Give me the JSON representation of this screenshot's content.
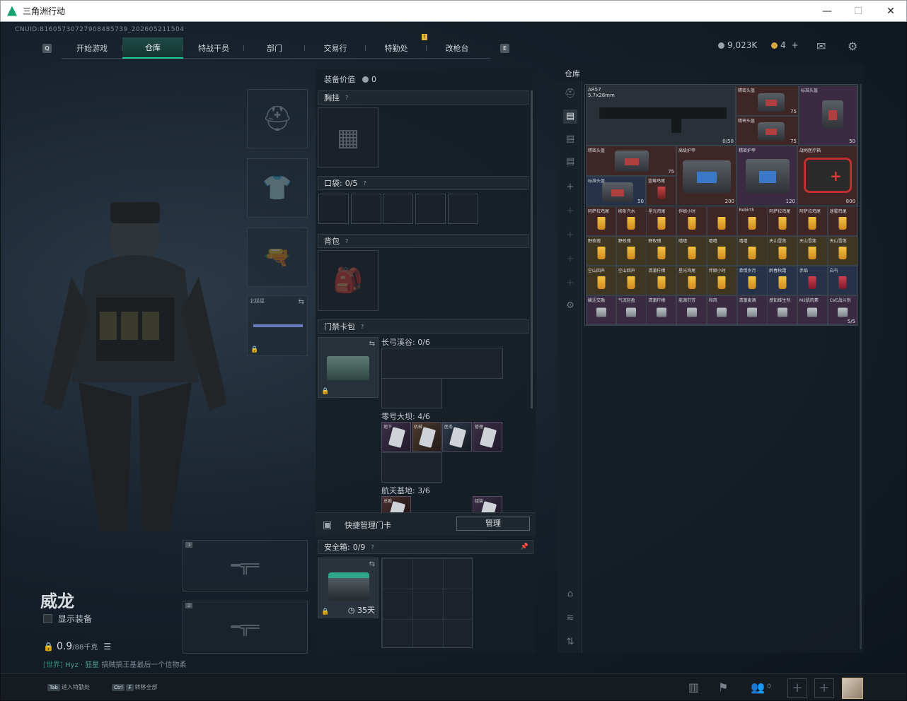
{
  "window": {
    "title": "三角洲行动",
    "minimize": "—",
    "maximize": "☐",
    "close": "✕"
  },
  "uid": "CNUID:8160573072790848573​9_20260521150​4",
  "nav": {
    "tabs": [
      "开始游戏",
      "仓库",
      "特战干员",
      "部门",
      "交易行",
      "特勤处",
      "改枪台"
    ],
    "active": "仓库",
    "left_key": "Q",
    "right_key": "E",
    "badge": "!"
  },
  "currency": {
    "coins": "9,023K",
    "gold": "4",
    "add": "+"
  },
  "character": {
    "name": "威龙",
    "show_equipment": "显示装备",
    "weight_value": "0.9",
    "weight_max": "/88千克",
    "melee_label": "北极星",
    "weapon_slot_1": "1",
    "weapon_slot_2": "2"
  },
  "chat": {
    "channel": "[世界]",
    "user": "Hyz",
    "sep": "·",
    "user2": "狂星",
    "text": "搞贼搞王基最后一个信物柔"
  },
  "middle": {
    "equip_value_label": "装备价值",
    "equip_value": "0",
    "chest_rig": "胸挂",
    "pockets": "口袋:",
    "pockets_count": "0/5",
    "backpack": "背包",
    "keycard": "门禁卡包",
    "keycard_groups": [
      {
        "name": "长弓溪谷: 0/6"
      },
      {
        "name": "零号大坝: 4/6",
        "cards": [
          "地下",
          "机械",
          "医务",
          "管理"
        ]
      },
      {
        "name": "航天基地: 3/6",
        "cards": [
          "总裁",
          "组装"
        ]
      }
    ],
    "quick_manage": "快捷管理门卡",
    "manage_btn": "管理",
    "safe_box": "安全箱:",
    "safe_count": "0/9",
    "safe_time": "35天"
  },
  "warehouse": {
    "title": "仓库",
    "capacity": "5/5",
    "items": [
      {
        "name": "AR57\n5.7x28mm",
        "qty": "0/50"
      },
      {
        "name": "精密头盔",
        "qty": "75"
      },
      {
        "name": "精密头盔",
        "qty": "75"
      },
      {
        "name": "标准头盔",
        "qty": "50"
      },
      {
        "name": "精密头盔",
        "qty": "75"
      },
      {
        "name": "高级护甲",
        "qty": "200"
      },
      {
        "name": "精密护甲",
        "qty": "120"
      },
      {
        "name": "战地医疗箱",
        "qty": "800"
      },
      {
        "name": "标准头盔",
        "qty": "50"
      },
      {
        "name": "蓝莓鸡尾",
        "qty": ""
      }
    ],
    "drink_row1": [
      "阿萨拉鸡尾",
      "柳条汽水",
      "星光鸡尾",
      "伴娘小时",
      "",
      "Rebirth",
      "阿萨拉鸡尾",
      "阿萨拉鸡尾",
      "迷雾鸡尾"
    ],
    "drink_row2": [
      "野玫瑰",
      "野玫瑰",
      "野玫瑰",
      "嘻嘻",
      "嘻嘻",
      "嘻嘻",
      "天山雪莲",
      "天山雪莲",
      "天山雪莲"
    ],
    "drink_row3": [
      "空山回声",
      "空山回声",
      "清澈柠檬",
      "星光鸡尾",
      "伴娘小时",
      "柔情岁月",
      "醉春秋霜",
      "赤焰",
      "白鸟"
    ],
    "drink_row4": [
      "酸涩交融",
      "气流轻盈",
      "清澈柠檬",
      "能源芬芳",
      "和风",
      "清澈麦酒",
      "感知维生剂",
      "M2肌肉素",
      "CVE战斗剂"
    ]
  },
  "bottom": {
    "hint1_key": "Tab",
    "hint1": "进入特勤处",
    "hint2_key1": "Ctrl",
    "hint2_key2": "F",
    "hint2": "转移全部",
    "friends": "0"
  }
}
